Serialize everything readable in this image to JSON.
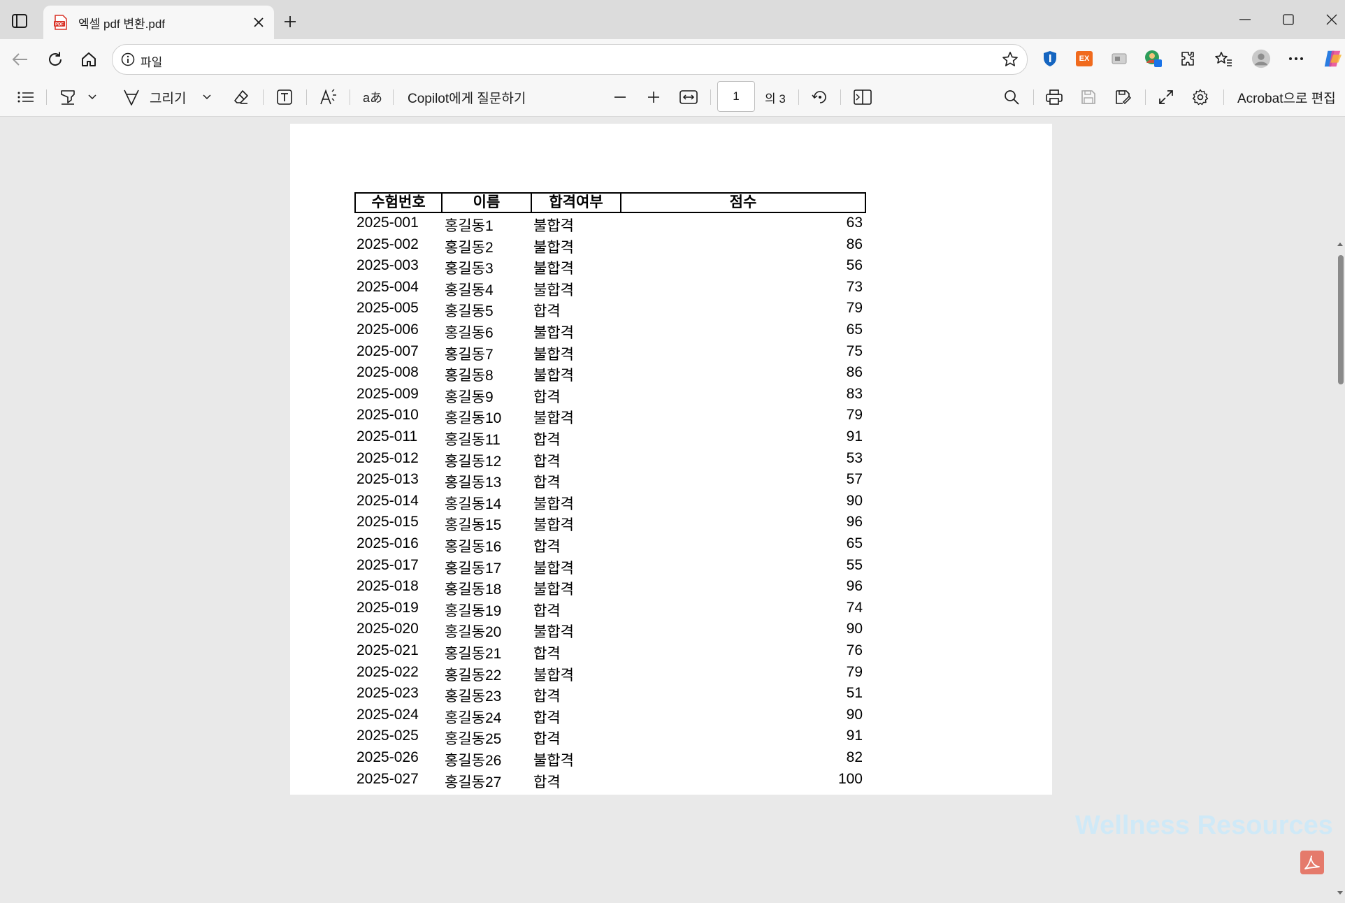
{
  "tab": {
    "title": "엑셀 pdf 변환.pdf",
    "favicon_label": "PDF"
  },
  "address": {
    "text": "파일"
  },
  "pdf_toolbar": {
    "draw_label": "그리기",
    "copilot_label": "Copilot에게 질문하기",
    "page_current": "1",
    "page_total": "의 3",
    "acrobat_label": "Acrobat으로 편집",
    "text_icon_glyph": "aあ"
  },
  "extensions": {
    "ex_label": "EX"
  },
  "table": {
    "headers": [
      "수험번호",
      "이름",
      "합격여부",
      "점수"
    ],
    "rows": [
      [
        "2025-001",
        "홍길동1",
        "불합격",
        "63"
      ],
      [
        "2025-002",
        "홍길동2",
        "불합격",
        "86"
      ],
      [
        "2025-003",
        "홍길동3",
        "불합격",
        "56"
      ],
      [
        "2025-004",
        "홍길동4",
        "불합격",
        "73"
      ],
      [
        "2025-005",
        "홍길동5",
        "합격",
        "79"
      ],
      [
        "2025-006",
        "홍길동6",
        "불합격",
        "65"
      ],
      [
        "2025-007",
        "홍길동7",
        "불합격",
        "75"
      ],
      [
        "2025-008",
        "홍길동8",
        "불합격",
        "86"
      ],
      [
        "2025-009",
        "홍길동9",
        "합격",
        "83"
      ],
      [
        "2025-010",
        "홍길동10",
        "불합격",
        "79"
      ],
      [
        "2025-011",
        "홍길동11",
        "합격",
        "91"
      ],
      [
        "2025-012",
        "홍길동12",
        "합격",
        "53"
      ],
      [
        "2025-013",
        "홍길동13",
        "합격",
        "57"
      ],
      [
        "2025-014",
        "홍길동14",
        "불합격",
        "90"
      ],
      [
        "2025-015",
        "홍길동15",
        "불합격",
        "96"
      ],
      [
        "2025-016",
        "홍길동16",
        "합격",
        "65"
      ],
      [
        "2025-017",
        "홍길동17",
        "불합격",
        "55"
      ],
      [
        "2025-018",
        "홍길동18",
        "불합격",
        "96"
      ],
      [
        "2025-019",
        "홍길동19",
        "합격",
        "74"
      ],
      [
        "2025-020",
        "홍길동20",
        "불합격",
        "90"
      ],
      [
        "2025-021",
        "홍길동21",
        "합격",
        "76"
      ],
      [
        "2025-022",
        "홍길동22",
        "불합격",
        "79"
      ],
      [
        "2025-023",
        "홍길동23",
        "합격",
        "51"
      ],
      [
        "2025-024",
        "홍길동24",
        "합격",
        "90"
      ],
      [
        "2025-025",
        "홍길동25",
        "합격",
        "91"
      ],
      [
        "2025-026",
        "홍길동26",
        "불합격",
        "82"
      ],
      [
        "2025-027",
        "홍길동27",
        "합격",
        "100"
      ]
    ]
  },
  "watermark": {
    "text": "Wellness Resources"
  },
  "colors": {
    "accent": "#1a73e8",
    "pdf_red": "#d93025"
  }
}
